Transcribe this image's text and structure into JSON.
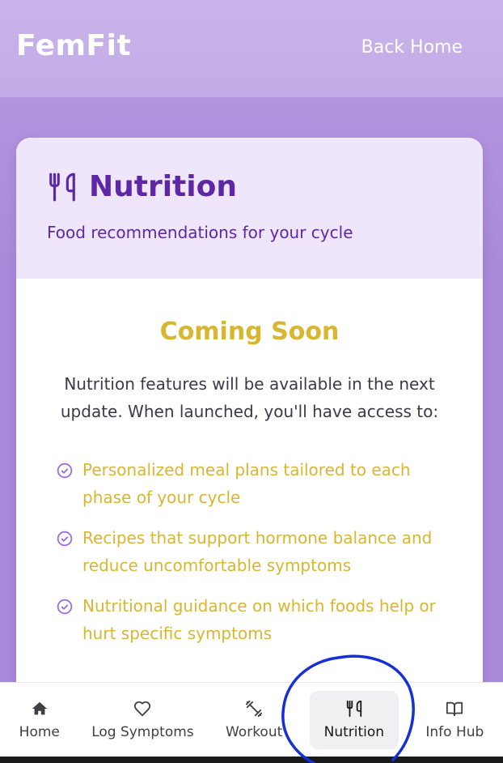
{
  "header": {
    "brand": "FemFit",
    "back_label": "Back Home"
  },
  "card": {
    "icon": "fork-knife-icon",
    "title": "Nutrition",
    "subtitle": "Food recommendations for your cycle",
    "coming_soon": "Coming Soon",
    "intro": "Nutrition features will be available in the next update. When launched, you'll have access to:",
    "features": [
      {
        "icon": "check-circle-icon",
        "text": "Personalized meal plans tailored to each phase of your cycle"
      },
      {
        "icon": "check-circle-icon",
        "text": "Recipes that support hormone balance and reduce uncomfortable symptoms"
      },
      {
        "icon": "check-circle-icon",
        "text": "Nutritional guidance on which foods help or hurt specific symptoms"
      }
    ]
  },
  "nav": {
    "items": [
      {
        "icon": "home-icon",
        "label": "Home",
        "active": false
      },
      {
        "icon": "heart-icon",
        "label": "Log Symptoms",
        "active": false
      },
      {
        "icon": "dumbbell-icon",
        "label": "Workout",
        "active": false
      },
      {
        "icon": "fork-knife-icon",
        "label": "Nutrition",
        "active": true
      },
      {
        "icon": "book-icon",
        "label": "Info Hub",
        "active": false
      }
    ]
  },
  "colors": {
    "background": "#a98ad9",
    "header": "#c3ace6",
    "primary_purple": "#5d27a6",
    "accent_gold": "#d8b630",
    "card_header_bg": "#efe6fb",
    "check_purple": "#9b6fe0",
    "annotation_blue": "#1530d6"
  }
}
